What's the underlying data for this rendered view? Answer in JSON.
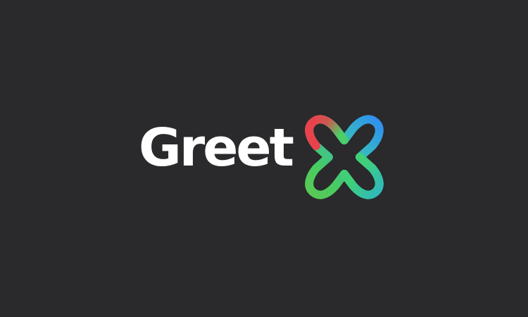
{
  "brand": {
    "wordmark": "Greet",
    "logo_name": "GreetX",
    "colors": {
      "background": "#2a292b",
      "wordmark": "#ffffff",
      "gradient_red": "#e8424c",
      "gradient_green": "#44cc66",
      "gradient_blue": "#2f8ff0"
    }
  }
}
